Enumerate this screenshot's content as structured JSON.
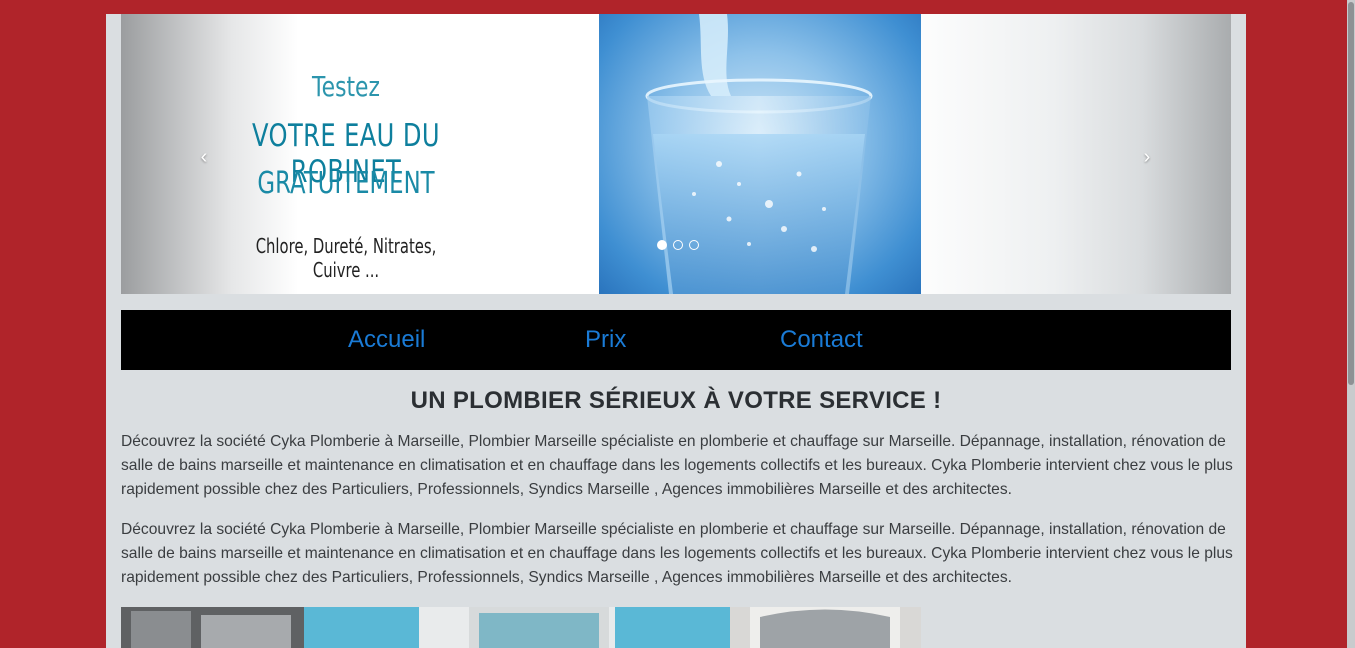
{
  "carousel": {
    "slide": {
      "line1": "Testez",
      "line2": "VOTRE EAU DU ROBINET",
      "line3": "GRATUITEMENT",
      "line4": "Chlore, Dureté, Nitrates, Cuivre ..."
    },
    "prev_label": "‹",
    "next_label": "›",
    "slide_count": 3,
    "active_slide": 1
  },
  "nav": {
    "items": [
      {
        "label": "Accueil"
      },
      {
        "label": "Prix"
      },
      {
        "label": "Contact"
      }
    ]
  },
  "main": {
    "title": "UN PLOMBIER SÉRIEUX À VOTRE SERVICE !",
    "paragraphs": [
      "Découvrez la société Cyka Plomberie à Marseille, Plombier Marseille spécialiste en plomberie et chauffage sur Marseille. Dépannage, installation, rénovation de salle de bains marseille et maintenance en climatisation et en chauffage dans les logements collectifs et les bureaux. Cyka Plomberie intervient chez vous le plus rapidement possible chez des Particuliers, Professionnels, Syndics Marseille , Agences immobilières Marseille et des architectes.",
      "Découvrez la société Cyka Plomberie à Marseille, Plombier Marseille spécialiste en plomberie et chauffage sur Marseille. Dépannage, installation, rénovation de salle de bains marseille et maintenance en climatisation et en chauffage dans les logements collectifs et les bureaux. Cyka Plomberie intervient chez vous le plus rapidement possible chez des Particuliers, Professionnels, Syndics Marseille , Agences immobilières Marseille et des architectes."
    ]
  },
  "colors": {
    "body_background": "#b0242a",
    "container_background": "#dadee1",
    "navbar_background": "#000000",
    "nav_link": "#1a7bd6",
    "slide_text_teal": "#0e7f9d"
  },
  "gallery": {
    "images": [
      "shower-cabin-image",
      "shower-cabin-image",
      "shower-cabin-image"
    ]
  }
}
